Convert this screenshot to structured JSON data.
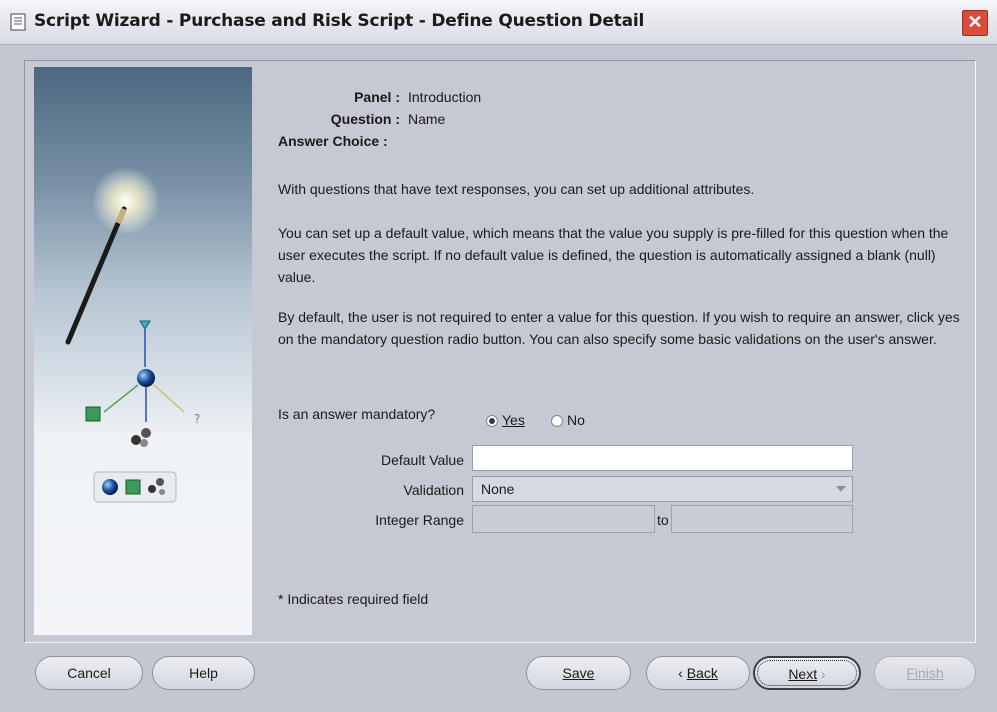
{
  "window": {
    "title": "Script Wizard - Purchase and Risk Script - Define Question Detail",
    "close_glyph": "✕"
  },
  "details": {
    "panel_label": "Panel :",
    "panel_value": "Introduction",
    "question_label": "Question :",
    "question_value": "Name",
    "answer_choice_label": "Answer Choice :"
  },
  "paragraphs": {
    "p1": "With questions that have text responses, you can set up additional attributes.",
    "p2": "You can set up a default value, which means that the value you supply is pre-filled for this question when the user executes the script. If no default value is defined, the question is automatically assigned a blank (null) value.",
    "p3": "By default, the user is not required to enter a value for this question. If you wish to require an answer, click yes on the mandatory question radio button. You can also specify some basic validations on the user's answer."
  },
  "mandatory": {
    "label": "Is an answer mandatory?",
    "yes_label": "Yes",
    "no_label": "No",
    "selected": "Yes"
  },
  "form": {
    "default_value_label": "Default Value",
    "default_value": "",
    "validation_label": "Validation",
    "validation_value": "None",
    "integer_range_label": "Integer Range",
    "range_from": "",
    "range_to_label": "to",
    "range_to": ""
  },
  "required_note": "* Indicates required field",
  "buttons": {
    "cancel": "Cancel",
    "help": "Help",
    "save": "Save",
    "back": "Back",
    "next": "Next",
    "finish": "Finish"
  }
}
